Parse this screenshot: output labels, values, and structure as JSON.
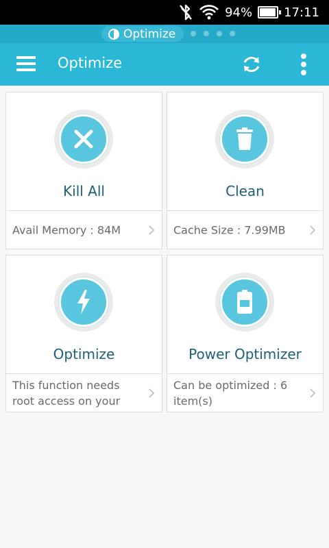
{
  "status_bar": {
    "battery_percent": "94%",
    "battery_level": 0.94,
    "time": "17:11",
    "icons": [
      "bluetooth-off-icon",
      "wifi-icon",
      "battery-icon"
    ]
  },
  "pager": {
    "active_label": "Optimize",
    "dot_count": 4
  },
  "app_bar": {
    "title": "Optimize",
    "color": "#2bb7d6",
    "icons": [
      "menu-icon",
      "refresh-icon",
      "more-vert-icon"
    ]
  },
  "cards": [
    {
      "title": "Kill All",
      "description": "Avail Memory : 84M",
      "icon": "close-icon"
    },
    {
      "title": "Clean",
      "description": "Cache Size : 7.99MB",
      "icon": "trash-icon"
    },
    {
      "title": "Optimize",
      "description": "This function needs root access on your",
      "icon": "lightning-icon"
    },
    {
      "title": "Power Optimizer",
      "description": "Can be optimized : 6 item(s)",
      "icon": "battery-icon"
    }
  ],
  "colors": {
    "accent": "#2bb7d6",
    "icon_fill": "#59c6df",
    "title_text": "#1e5f78"
  }
}
